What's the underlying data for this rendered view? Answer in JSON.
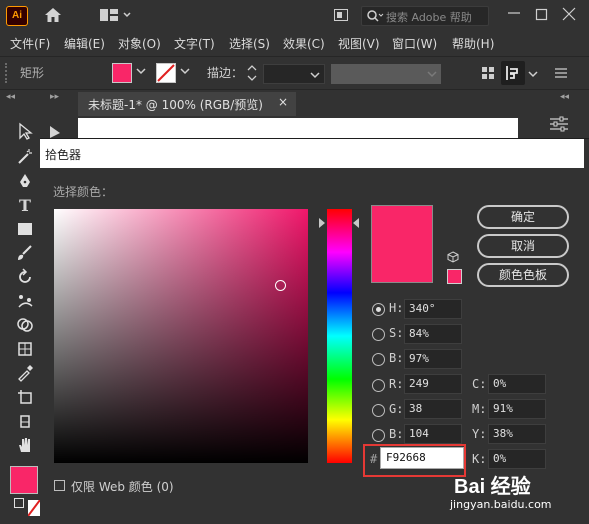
{
  "app": {
    "logo": "Ai",
    "search_placeholder": "搜索 Adobe 帮助"
  },
  "menu": [
    "文件(F)",
    "编辑(E)",
    "对象(O)",
    "文字(T)",
    "选择(S)",
    "效果(C)",
    "视图(V)",
    "窗口(W)",
    "帮助(H)"
  ],
  "controlbar": {
    "object_label": "矩形",
    "stroke_label": "描边：",
    "fill_color": "#f92668"
  },
  "document": {
    "tab_title": "未标题-1* @ 100% (RGB/预览)",
    "close": "×"
  },
  "dialog": {
    "title": "拾色器",
    "select_label": "选择颜色：",
    "current_color": "#f92668",
    "buttons": {
      "ok": "确定",
      "cancel": "取消",
      "swatches": "颜色色板"
    },
    "hsb": [
      {
        "label": "H:",
        "value": "340°",
        "selected": true
      },
      {
        "label": "S:",
        "value": "84%",
        "selected": false
      },
      {
        "label": "B:",
        "value": "97%",
        "selected": false
      }
    ],
    "rgb": [
      {
        "label": "R:",
        "value": "249"
      },
      {
        "label": "G:",
        "value": "38"
      },
      {
        "label": "B:",
        "value": "104"
      }
    ],
    "cmyk": [
      {
        "label": "C:",
        "value": "0%"
      },
      {
        "label": "M:",
        "value": "91%"
      },
      {
        "label": "Y:",
        "value": "38%"
      },
      {
        "label": "K:",
        "value": "0%"
      }
    ],
    "hex_prefix": "#",
    "hex_value": "F92668",
    "web_only_label": "仅限 Web 颜色 (0)"
  },
  "watermark": {
    "brand": "Bai 经验",
    "url": "jingyan.baidu.com"
  }
}
